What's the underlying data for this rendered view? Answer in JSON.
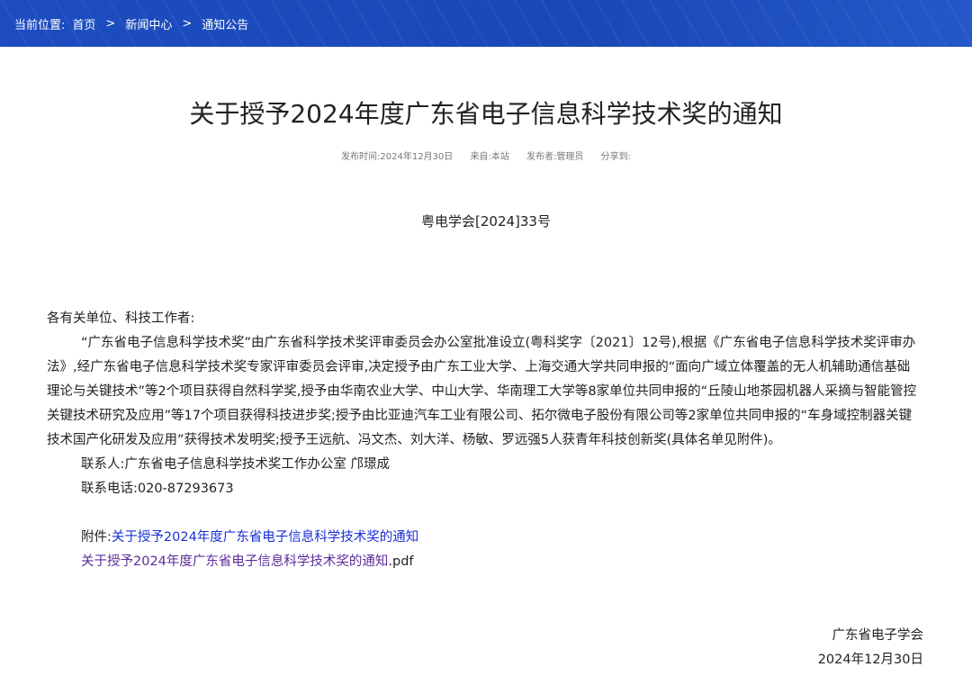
{
  "breadcrumb": {
    "label": "当前位置:",
    "items": [
      "首页",
      "新闻中心",
      "通知公告"
    ],
    "separator": ">"
  },
  "article": {
    "title": "关于授予2024年度广东省电子信息科学技术奖的通知",
    "meta": {
      "publish_time": "发布时间:2024年12月30日",
      "source": "来自:本站",
      "publisher": "发布者:管理员",
      "share": "分享到:"
    },
    "doc_number": "粤电学会[2024]33号",
    "salutation": "各有关单位、科技工作者:",
    "paragraph": "“广东省电子信息科学技术奖”由广东省科学技术奖评审委员会办公室批准设立(粤科奖字〔2021〕12号),根据《广东省电子信息科学技术奖评审办法》,经广东省电子信息科学技术奖专家评审委员会评审,决定授予由广东工业大学、上海交通大学共同申报的“面向广域立体覆盖的无人机辅助通信基础理论与关键技术”等2个项目获得自然科学奖,授予由华南农业大学、中山大学、华南理工大学等8家单位共同申报的“丘陵山地茶园机器人采摘与智能管控关键技术研究及应用”等17个项目获得科技进步奖;授予由比亚迪汽车工业有限公司、拓尔微电子股份有限公司等2家单位共同申报的“车身域控制器关键技术国产化研发及应用”获得技术发明奖;授予王远航、冯文杰、刘大洋、杨敏、罗远强5人获青年科技创新奖(具体名单见附件)。",
    "contact_person": "联系人:广东省电子信息科学技术奖工作办公室 邝璟成",
    "contact_phone": "联系电话:020-87293673",
    "attachment_label": "附件:",
    "attachment_link": "关于授予2024年度广东省电子信息科学技术奖的通知",
    "attachment_file_name": "关于授予2024年度广东省电子信息科学技术奖的通知",
    "attachment_file_ext": ".pdf",
    "signature_org": "广东省电子学会",
    "signature_date": "2024年12月30日"
  },
  "colors": {
    "header_bg": "#1948b8",
    "link_blue": "#1a2fd6",
    "link_visited": "#5c2d9a"
  }
}
